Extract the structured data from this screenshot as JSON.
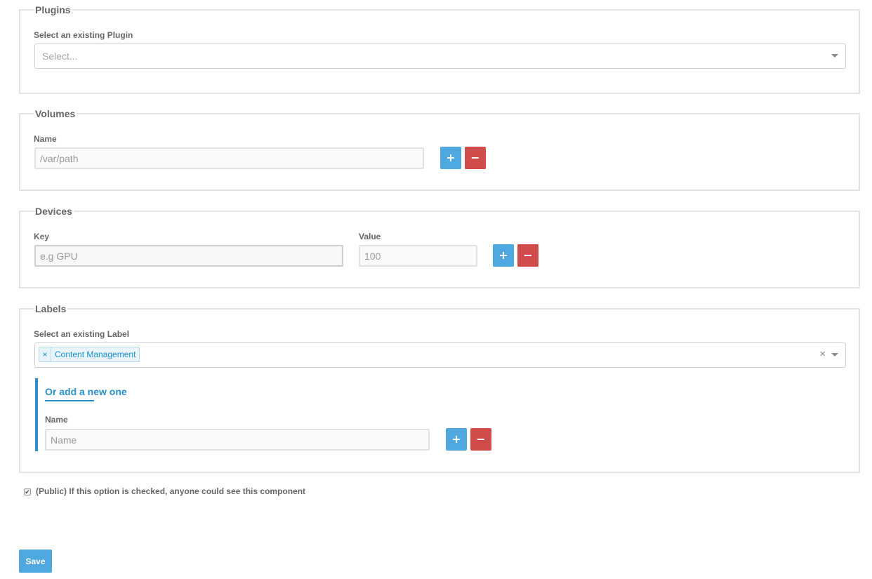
{
  "plugins": {
    "legend": "Plugins",
    "label": "Select an existing Plugin",
    "select_placeholder": "Select..."
  },
  "volumes": {
    "legend": "Volumes",
    "label": "Name",
    "placeholder": "/var/path",
    "add_icon": "+",
    "remove_icon": "−"
  },
  "devices": {
    "legend": "Devices",
    "key_label": "Key",
    "key_placeholder": "e.g GPU",
    "value_label": "Value",
    "value_placeholder": "100",
    "add_icon": "+",
    "remove_icon": "−"
  },
  "labels": {
    "legend": "Labels",
    "label": "Select an existing Label",
    "selected_tags": [
      "Content Management"
    ],
    "tag_remove_icon": "×",
    "clear_icon": "×",
    "new_title": "Or add a new one",
    "name_label": "Name",
    "name_placeholder": "Name",
    "add_icon": "+",
    "remove_icon": "−"
  },
  "public_option": {
    "checked": true,
    "check_icon": "✔",
    "label": "(Public) If this option is checked, anyone could see this component"
  },
  "save_label": "Save",
  "colors": {
    "primary": "#4ea7de",
    "danger": "#cf4c4b",
    "accent": "#2a8fc9"
  }
}
